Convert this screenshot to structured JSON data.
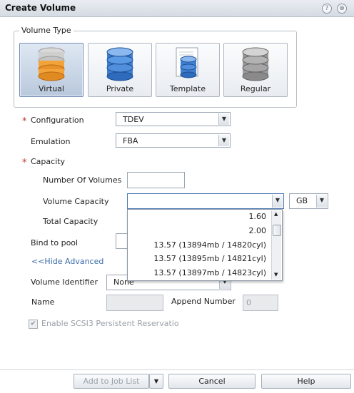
{
  "dialog": {
    "title": "Create Volume",
    "help_icon": "?",
    "close_icon": "⊗"
  },
  "volume_type": {
    "legend": "Volume Type",
    "tiles": [
      {
        "label": "Virtual",
        "icon": "virtual-db-icon",
        "selected": true
      },
      {
        "label": "Private",
        "icon": "private-db-icon",
        "selected": false
      },
      {
        "label": "Template",
        "icon": "template-db-icon",
        "selected": false
      },
      {
        "label": "Regular",
        "icon": "regular-db-icon",
        "selected": false
      }
    ]
  },
  "form": {
    "required_mark": "*",
    "configuration": {
      "label": "Configuration",
      "value": "TDEV"
    },
    "emulation": {
      "label": "Emulation",
      "value": "FBA"
    },
    "capacity": {
      "label": "Capacity"
    },
    "number_of_volumes": {
      "label": "Number Of Volumes",
      "value": ""
    },
    "volume_capacity": {
      "label": "Volume Capacity",
      "value": "",
      "unit": "GB"
    },
    "total_capacity": {
      "label": "Total Capacity"
    },
    "bind_to_pool": {
      "label": "Bind to pool"
    },
    "hide_advanced": "<<Hide Advanced",
    "volume_identifier": {
      "label": "Volume Identifier",
      "value": "None"
    },
    "name": {
      "label": "Name",
      "value": ""
    },
    "append_number": {
      "label": "Append Number",
      "value": "0"
    },
    "scsi3": {
      "label": "Enable SCSI3 Persistent Reservatio",
      "checked": true
    }
  },
  "capacity_dropdown": {
    "options": [
      "1.60",
      "2.00",
      "13.57 (13894mb / 14820cyl)",
      "13.57 (13895mb / 14821cyl)",
      "13.57 (13897mb / 14823cyl)"
    ]
  },
  "buttons": {
    "add_to_job_list": "Add to Job List",
    "cancel": "Cancel",
    "help": "Help"
  },
  "colors": {
    "accent": "#3a6aa8",
    "required": "#c0392b",
    "selected_tile": "#b9c8dc"
  }
}
